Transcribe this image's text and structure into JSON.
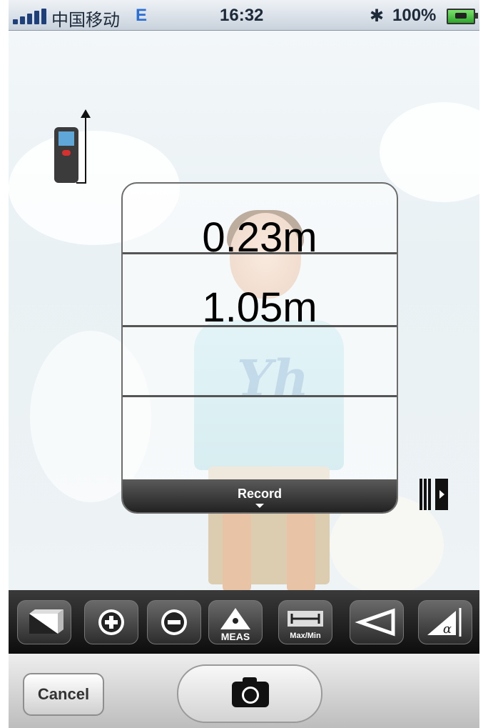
{
  "status_bar": {
    "carrier": "中国移动",
    "network": "E",
    "time": "16:32",
    "battery": "100%"
  },
  "panel": {
    "readings": [
      "0.23m",
      "1.05m"
    ],
    "record_label": "Record"
  },
  "toolbar": {
    "tools": [
      {
        "icon": "area-icon"
      },
      {
        "icon": "add-icon"
      },
      {
        "icon": "subtract-icon"
      },
      {
        "icon": "meas-icon",
        "label": "MEAS"
      },
      {
        "icon": "maxmin-icon",
        "label": "Max/Min"
      },
      {
        "icon": "triangle-icon"
      },
      {
        "icon": "angle-icon",
        "label": "α"
      }
    ]
  },
  "bottom": {
    "cancel_label": "Cancel"
  },
  "colors": {
    "status_bar_bg": "#d9e0e8",
    "toolbar_bg": "#1f1f1f",
    "record_bar_bg": "#333333"
  }
}
